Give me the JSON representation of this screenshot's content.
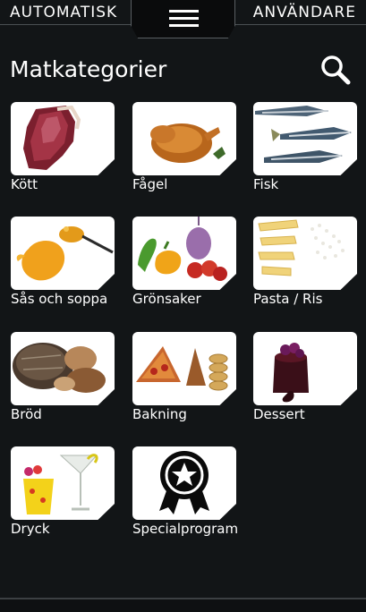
{
  "header": {
    "left_link": "AUTOMATISK",
    "right_link": "ANVÄNDARE",
    "menu_icon": "hamburger-menu-icon"
  },
  "page": {
    "title": "Matkategorier",
    "search_icon": "search-icon"
  },
  "categories": [
    {
      "label": "Kött",
      "image": "meat-image"
    },
    {
      "label": "Fågel",
      "image": "poultry-image"
    },
    {
      "label": "Fisk",
      "image": "fish-image"
    },
    {
      "label": "Sås och soppa",
      "image": "sauce-image"
    },
    {
      "label": "Grönsaker",
      "image": "vegetables-image"
    },
    {
      "label": "Pasta / Ris",
      "image": "pasta-rice-image"
    },
    {
      "label": "Bröd",
      "image": "bread-image"
    },
    {
      "label": "Bakning",
      "image": "baking-image"
    },
    {
      "label": "Dessert",
      "image": "dessert-image"
    },
    {
      "label": "Dryck",
      "image": "drink-image"
    },
    {
      "label": "Specialprogram",
      "image": "special-program-badge-icon"
    }
  ],
  "colors": {
    "background": "#121517",
    "text": "#ffffff",
    "tile": "#ffffff"
  }
}
